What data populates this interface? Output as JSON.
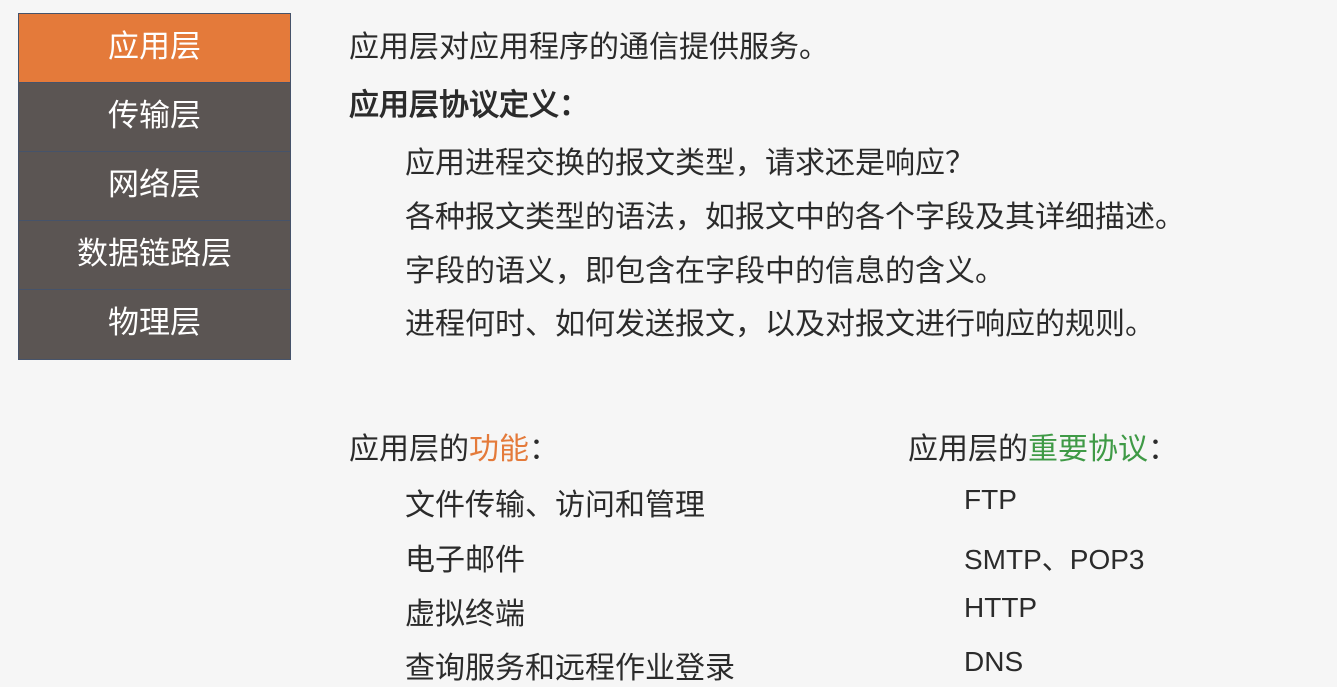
{
  "layers": [
    "应用层",
    "传输层",
    "网络层",
    "数据链路层",
    "物理层"
  ],
  "intro": "应用层对应用程序的通信提供服务。",
  "protocol_def": {
    "title": "应用层协议定义：",
    "items": [
      "应用进程交换的报文类型，请求还是响应？",
      "各种报文类型的语法，如报文中的各个字段及其详细描述。",
      "字段的语义，即包含在字段中的信息的含义。",
      "进程何时、如何发送报文，以及对报文进行响应的规则。"
    ]
  },
  "functions": {
    "prefix": "应用层的",
    "highlight": "功能",
    "suffix": "：",
    "items": [
      "文件传输、访问和管理",
      "电子邮件",
      "虚拟终端",
      "查询服务和远程作业登录"
    ]
  },
  "protocols": {
    "prefix": "应用层的",
    "highlight": "重要协议",
    "suffix": "：",
    "items": [
      "FTP",
      "SMTP、POP3",
      "HTTP",
      "DNS"
    ]
  },
  "colors": {
    "active_layer": "#e47a3a",
    "layer": "#5b5553",
    "function_highlight": "#e47a3a",
    "protocol_highlight": "#3f9a46"
  }
}
